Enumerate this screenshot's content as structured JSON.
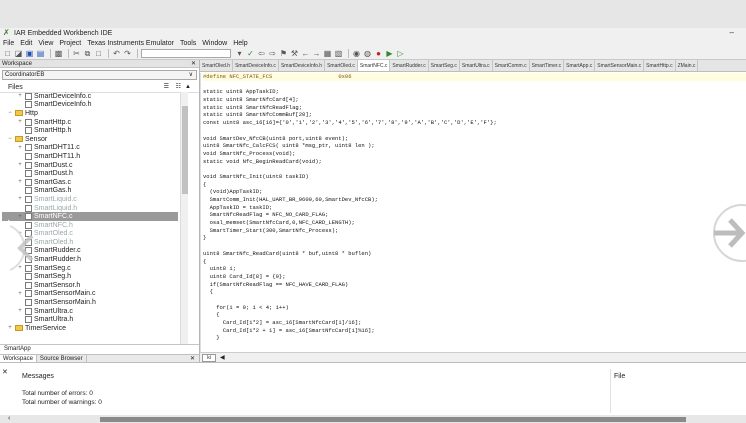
{
  "window": {
    "title": "IAR Embedded Workbench IDE",
    "minimize": "–"
  },
  "menu": [
    "File",
    "Edit",
    "View",
    "Project",
    "Texas Instruments Emulator",
    "Tools",
    "Window",
    "Help"
  ],
  "workspace": {
    "header": "Workspace",
    "config": "CoordinatorEB",
    "files_label": "Files",
    "tree": [
      {
        "indent": 1,
        "exp": "+",
        "kind": "file",
        "label": "SmartDeviceInfo.c"
      },
      {
        "indent": 1,
        "exp": "",
        "kind": "file",
        "label": "SmartDeviceInfo.h"
      },
      {
        "indent": 0,
        "exp": "−",
        "kind": "dir",
        "label": "Http"
      },
      {
        "indent": 1,
        "exp": "+",
        "kind": "file",
        "label": "SmartHttp.c"
      },
      {
        "indent": 1,
        "exp": "",
        "kind": "file",
        "label": "SmartHttp.h"
      },
      {
        "indent": 0,
        "exp": "−",
        "kind": "dir",
        "label": "Sensor"
      },
      {
        "indent": 1,
        "exp": "+",
        "kind": "file",
        "label": "SmartDHT11.c"
      },
      {
        "indent": 1,
        "exp": "",
        "kind": "file",
        "label": "SmartDHT11.h"
      },
      {
        "indent": 1,
        "exp": "+",
        "kind": "file",
        "label": "SmartDust.c"
      },
      {
        "indent": 1,
        "exp": "",
        "kind": "file",
        "label": "SmartDust.h"
      },
      {
        "indent": 1,
        "exp": "+",
        "kind": "file",
        "label": "SmartGas.c"
      },
      {
        "indent": 1,
        "exp": "",
        "kind": "file",
        "label": "SmartGas.h"
      },
      {
        "indent": 1,
        "exp": "+",
        "kind": "file",
        "label": "SmartLiquid.c"
      },
      {
        "indent": 1,
        "exp": "",
        "kind": "file",
        "label": "SmartLiquid.h"
      },
      {
        "indent": 1,
        "exp": "+",
        "kind": "file",
        "label": "SmartNFC.c"
      },
      {
        "indent": 1,
        "exp": "",
        "kind": "file",
        "label": "SmartNFC.h"
      },
      {
        "indent": 1,
        "exp": "+",
        "kind": "file",
        "label": "SmartOled.c"
      },
      {
        "indent": 1,
        "exp": "",
        "kind": "file",
        "label": "SmartOled.h"
      },
      {
        "indent": 1,
        "exp": "+",
        "kind": "file",
        "label": "SmartRudder.c"
      },
      {
        "indent": 1,
        "exp": "",
        "kind": "file",
        "label": "SmartRudder.h"
      },
      {
        "indent": 1,
        "exp": "+",
        "kind": "file",
        "label": "SmartSeg.c"
      },
      {
        "indent": 1,
        "exp": "",
        "kind": "file",
        "label": "SmartSeg.h"
      },
      {
        "indent": 1,
        "exp": "",
        "kind": "file",
        "label": "SmartSensor.h"
      },
      {
        "indent": 1,
        "exp": "+",
        "kind": "file",
        "label": "SmartSensorMain.c"
      },
      {
        "indent": 1,
        "exp": "",
        "kind": "file",
        "label": "SmartSensorMain.h"
      },
      {
        "indent": 1,
        "exp": "+",
        "kind": "file",
        "label": "SmartUltra.c"
      },
      {
        "indent": 1,
        "exp": "",
        "kind": "file",
        "label": "SmartUltra.h"
      },
      {
        "indent": 0,
        "exp": "+",
        "kind": "dir",
        "label": "TimerService"
      }
    ],
    "bottom_tab": "SmartApp",
    "panel_tabs": [
      "Workspace",
      "Source Browser"
    ]
  },
  "editor": {
    "tabs": [
      "SmartOled.h",
      "SmartDeviceInfo.c",
      "SmartDeviceInfo.h",
      "SmartOled.c",
      "SmartNFC.c",
      "SmartRudder.c",
      "SmartSeg.c",
      "SmartUltra.c",
      "SmartComm.c",
      "SmartTimer.c",
      "SmartApp.c",
      "SmartSensorMain.c",
      "SmartHttp.c",
      "ZMain.c"
    ],
    "active_tab": "SmartNFC.c",
    "code": [
      "#define NFC_STATE_FCS                    0x06",
      "",
      "static uint8 AppTaskID;",
      "static uint8 SmartNfcCard[4];",
      "static uint8 SmartNfcReadFlag;",
      "static uint8 SmartNfcCommBuf[20];",
      "const uint8 asc_16[16]={'0','1','2','3','4','5','6','7','8','9','A','B','C','D','E','F'};",
      "",
      "void SmartDev_NfcCB(uint8 port,uint8 event);",
      "uint8 SmartNfc_CalcFCS( uint8 *msg_ptr, uint8 len );",
      "void SmartNfc_Process(void);",
      "static void Nfc_BeginReadCard(void);",
      "",
      "void SmartNfc_Init(uint8 taskID)",
      "{",
      "  (void)AppTaskID;",
      "  SmartComm_Init(HAL_UART_BR_9600,60,SmartDev_NfcCB);",
      "  AppTaskID = taskID;",
      "  SmartNfcReadFlag = NFC_NO_CARD_FLAG;",
      "  osal_memset(SmartNfcCard,0,NFC_CARD_LENGTH);",
      "  SmartTimer_Start(300,SmartNfc_Process);",
      "}",
      "",
      "uint8 SmartNfc_ReadCard(uint8 * buf,uint8 * buflen)",
      "{",
      "  uint8 i;",
      "  uint8 Card_Id[8] = {0};",
      "  if(SmartNfcReadFlag == NFC_HAVE_CARD_FLAG)",
      "  {",
      "",
      "    for(i = 0; i < 4; i++)",
      "    {",
      "      Card_Id[i*2] = asc_16[SmartNfcCard[i]/16];",
      "      Card_Id[i*2 + 1] = asc_16[SmartNfcCard[i]%16];",
      "    }"
    ],
    "bottom_left": "ki"
  },
  "messages": {
    "header": "Messages",
    "file_col": "File",
    "lines": [
      "Total number of errors: 0",
      "Total number of warnings: 0"
    ]
  }
}
